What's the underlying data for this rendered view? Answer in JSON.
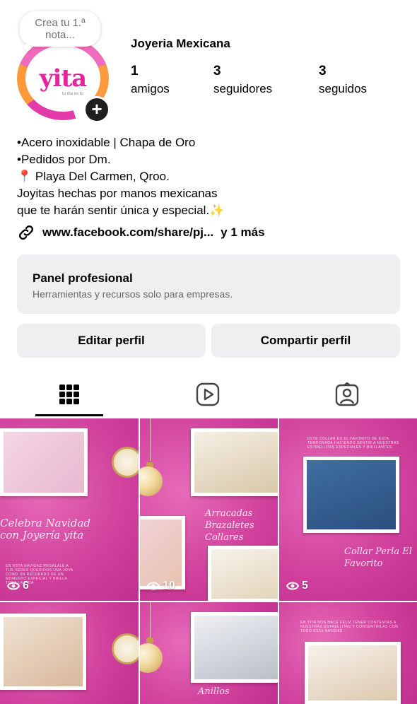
{
  "profile": {
    "note_line1": "Crea tu 1.ª",
    "note_line2": "nota...",
    "avatar_logo_text": "yita",
    "avatar_logo_sub": "tu día es tú",
    "username": "Joyeria Mexicana",
    "stats": [
      {
        "value": "1",
        "label": "amigos"
      },
      {
        "value": "3",
        "label": "seguidores"
      },
      {
        "value": "3",
        "label": "seguidos"
      }
    ]
  },
  "bio": {
    "line1": "•Acero inoxidable | Chapa de Oro",
    "line2": "•Pedidos por Dm.",
    "line3": "Playa Del Carmen, Qroo.",
    "line4": "Joyitas hechas por manos mexicanas",
    "line5": "que te harán sentir única y especial.",
    "line5_emoji": "✨",
    "link_text": "www.facebook.com/share/pj...",
    "link_more": "y 1 más"
  },
  "panel": {
    "title": "Panel profesional",
    "subtitle": "Herramientas y recursos solo para empresas."
  },
  "buttons": {
    "edit": "Editar perfil",
    "share": "Compartir perfil"
  },
  "tabs": [
    {
      "icon": "grid-icon",
      "active": true
    },
    {
      "icon": "reels-icon",
      "active": false
    },
    {
      "icon": "tagged-icon",
      "active": false
    }
  ],
  "posts": [
    {
      "views": "6",
      "script_text": "Celebra Navidad con Joyería yita",
      "tiny_text": "En esta Navidad regálale a tus seres queridos una joya como un recuerdo de un momento especial y brilla toda la vida"
    },
    {
      "views": "10",
      "script_text": "Arracadas Brazaletes Collares"
    },
    {
      "views": "5",
      "script_text": "Collar Perla El Favorito",
      "tiny_text": "Este collar es el favorito de esta temporada haciendo sentir a nuestras estrellitas especiales y brillantes."
    },
    {
      "views": "",
      "script_text": ""
    },
    {
      "views": "",
      "script_text": "Anillos"
    },
    {
      "views": "",
      "script_text": "",
      "tiny_text": "En yita nos hace feliz tener contentas a nuestras estrellitas y consentirlas con todo esta Navidad"
    }
  ],
  "colors": {
    "accent_pink": "#d94fa8",
    "button_bg": "#efeff2",
    "text_secondary": "#6b6b6b"
  }
}
